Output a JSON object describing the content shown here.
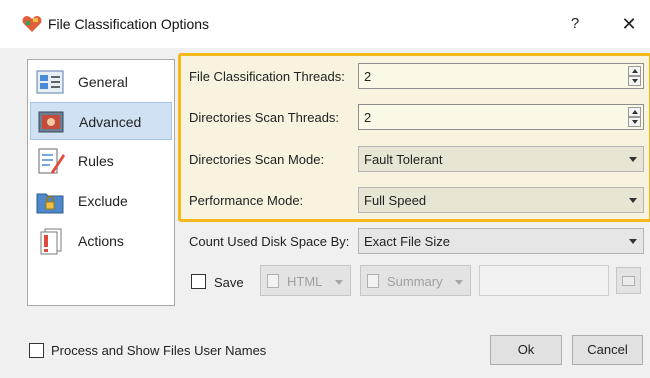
{
  "window": {
    "title": "File Classification Options",
    "help_label": "?",
    "close_label": "✕"
  },
  "sidebar": {
    "items": [
      {
        "label": "General",
        "icon": "general-icon"
      },
      {
        "label": "Advanced",
        "icon": "advanced-icon",
        "selected": true
      },
      {
        "label": "Rules",
        "icon": "rules-icon"
      },
      {
        "label": "Exclude",
        "icon": "exclude-icon"
      },
      {
        "label": "Actions",
        "icon": "actions-icon"
      }
    ]
  },
  "advanced": {
    "file_classification_threads": {
      "label": "File Classification Threads:",
      "value": "2"
    },
    "directories_scan_threads": {
      "label": "Directories Scan Threads:",
      "value": "2"
    },
    "directories_scan_mode": {
      "label": "Directories Scan Mode:",
      "value": "Fault Tolerant"
    },
    "performance_mode": {
      "label": "Performance Mode:",
      "value": "Full Speed"
    },
    "count_used_disk_space_by": {
      "label": "Count Used Disk Space By:",
      "value": "Exact File Size"
    },
    "highlight_color": "#f5b81c"
  },
  "save": {
    "checkbox_label": "Save",
    "checked": false,
    "format": "HTML",
    "report_type": "Summary",
    "path_value": ""
  },
  "footer": {
    "show_user_names_label": "Process and Show Files User Names",
    "show_user_names_checked": false,
    "ok_label": "Ok",
    "cancel_label": "Cancel"
  }
}
